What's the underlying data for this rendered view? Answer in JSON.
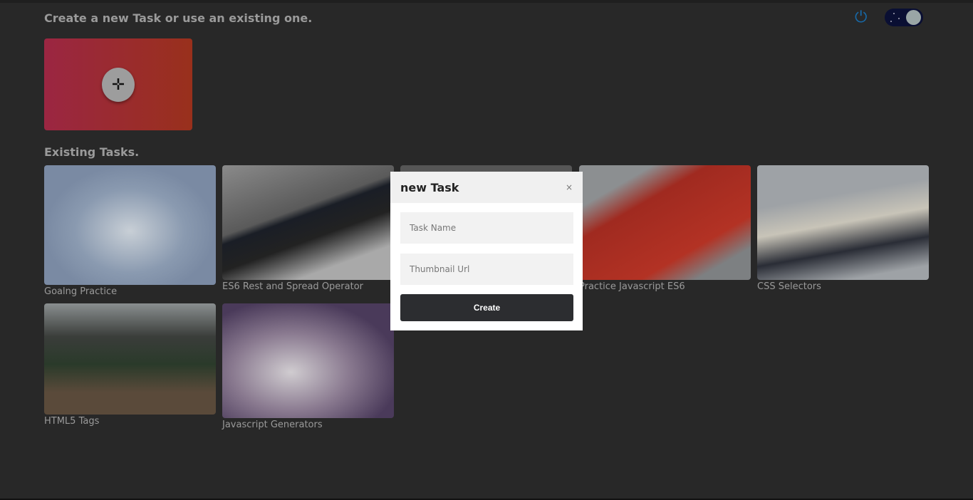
{
  "header": {
    "title": "Create a new Task or use an existing one.",
    "power_icon": "power-icon",
    "theme_toggle": {
      "state": "dark",
      "icon": "moon-icon"
    }
  },
  "new_task_card": {
    "icon": "move-plus-icon",
    "gradient": [
      "#9b2642",
      "#99301c"
    ]
  },
  "existing": {
    "title": "Existing Tasks.",
    "tasks": [
      {
        "label": "Goalng Practice"
      },
      {
        "label": "ES6 Rest and Spread Operator"
      },
      {
        "label": ""
      },
      {
        "label": "Practice Javascript ES6"
      },
      {
        "label": "CSS Selectors"
      },
      {
        "label": "HTML5 Tags"
      },
      {
        "label": "Javascript Generators"
      }
    ]
  },
  "modal": {
    "title": "new Task",
    "close": "×",
    "task_name_placeholder": "Task Name",
    "thumbnail_placeholder": "Thumbnail Url",
    "create_label": "Create"
  }
}
